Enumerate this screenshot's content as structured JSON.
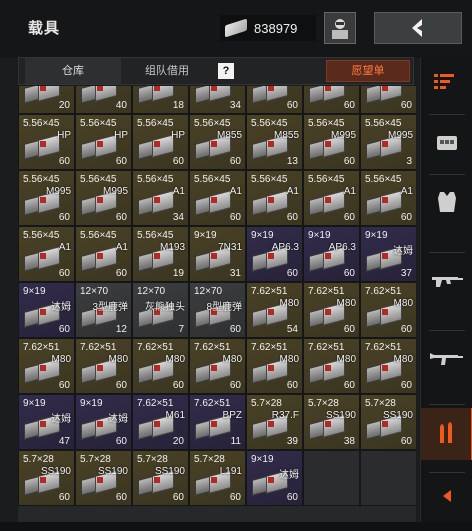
{
  "header": {
    "title": "载具",
    "money": "838979",
    "money_icon": "cash-icon",
    "avatar_icon": "character-icon",
    "back_icon": "back-arrow-icon"
  },
  "tabs": {
    "storage": "仓库",
    "team_borrow": "组队借用",
    "help": "?",
    "wishlist": "愿望单"
  },
  "colors": {
    "accent": "#f25a1c",
    "gold_slot": "#4a4226",
    "purple_slot": "#322c4c",
    "gray_slot": "#3c3d3f"
  },
  "rows": [
    [
      {
        "cal": "",
        "type": "",
        "qty": "20",
        "rarity": "gold"
      },
      {
        "cal": "",
        "type": "",
        "qty": "40",
        "rarity": "gold"
      },
      {
        "cal": "",
        "type": "",
        "qty": "18",
        "rarity": "gold"
      },
      {
        "cal": "",
        "type": "",
        "qty": "34",
        "rarity": "gold"
      },
      {
        "cal": "",
        "type": "",
        "qty": "60",
        "rarity": "gold"
      },
      {
        "cal": "",
        "type": "",
        "qty": "60",
        "rarity": "gold"
      },
      {
        "cal": "",
        "type": "",
        "qty": "60",
        "rarity": "gold"
      }
    ],
    [
      {
        "cal": "5.56×45",
        "type": "HP",
        "qty": "60",
        "rarity": "gold"
      },
      {
        "cal": "5.56×45",
        "type": "HP",
        "qty": "60",
        "rarity": "gold"
      },
      {
        "cal": "5.56×45",
        "type": "HP",
        "qty": "60",
        "rarity": "gold"
      },
      {
        "cal": "5.56×45",
        "type": "M855",
        "qty": "60",
        "rarity": "gold"
      },
      {
        "cal": "5.56×45",
        "type": "M855",
        "qty": "13",
        "rarity": "gold"
      },
      {
        "cal": "5.56×45",
        "type": "M995",
        "qty": "60",
        "rarity": "gold"
      },
      {
        "cal": "5.56×45",
        "type": "M995",
        "qty": "3",
        "rarity": "gold"
      }
    ],
    [
      {
        "cal": "5.56×45",
        "type": "M995",
        "qty": "60",
        "rarity": "gold"
      },
      {
        "cal": "5.56×45",
        "type": "M995",
        "qty": "60",
        "rarity": "gold"
      },
      {
        "cal": "5.56×45",
        "type": "A1",
        "qty": "34",
        "rarity": "gold"
      },
      {
        "cal": "5.56×45",
        "type": "A1",
        "qty": "60",
        "rarity": "gold"
      },
      {
        "cal": "5.56×45",
        "type": "A1",
        "qty": "60",
        "rarity": "gold"
      },
      {
        "cal": "5.56×45",
        "type": "A1",
        "qty": "60",
        "rarity": "gold"
      },
      {
        "cal": "5.56×45",
        "type": "A1",
        "qty": "60",
        "rarity": "gold"
      }
    ],
    [
      {
        "cal": "5.56×45",
        "type": "A1",
        "qty": "60",
        "rarity": "gold"
      },
      {
        "cal": "5.56×45",
        "type": "A1",
        "qty": "60",
        "rarity": "gold"
      },
      {
        "cal": "5.56×45",
        "type": "M193",
        "qty": "19",
        "rarity": "gold"
      },
      {
        "cal": "9×19",
        "type": "7N31",
        "qty": "31",
        "rarity": "gold"
      },
      {
        "cal": "9×19",
        "type": "AP6.3",
        "qty": "60",
        "rarity": "purple"
      },
      {
        "cal": "9×19",
        "type": "AP6.3",
        "qty": "60",
        "rarity": "purple"
      },
      {
        "cal": "9×19",
        "type": "达姆",
        "qty": "37",
        "rarity": "purple"
      }
    ],
    [
      {
        "cal": "9×19",
        "type": "达姆",
        "qty": "60",
        "rarity": "purple"
      },
      {
        "cal": "12×70",
        "type": "3型鹿弹",
        "qty": "12",
        "rarity": "gray"
      },
      {
        "cal": "12×70",
        "type": "灰熊独头",
        "qty": "7",
        "rarity": "gray"
      },
      {
        "cal": "12×70",
        "type": "8型鹿弹",
        "qty": "60",
        "rarity": "gray"
      },
      {
        "cal": "7.62×51",
        "type": "M80",
        "qty": "54",
        "rarity": "gold"
      },
      {
        "cal": "7.62×51",
        "type": "M80",
        "qty": "60",
        "rarity": "gold"
      },
      {
        "cal": "7.62×51",
        "type": "M80",
        "qty": "60",
        "rarity": "gold"
      }
    ],
    [
      {
        "cal": "7.62×51",
        "type": "M80",
        "qty": "60",
        "rarity": "gold"
      },
      {
        "cal": "7.62×51",
        "type": "M80",
        "qty": "60",
        "rarity": "gold"
      },
      {
        "cal": "7.62×51",
        "type": "M80",
        "qty": "60",
        "rarity": "gold"
      },
      {
        "cal": "7.62×51",
        "type": "M80",
        "qty": "60",
        "rarity": "gold"
      },
      {
        "cal": "7.62×51",
        "type": "M80",
        "qty": "60",
        "rarity": "gold"
      },
      {
        "cal": "7.62×51",
        "type": "M80",
        "qty": "60",
        "rarity": "gold"
      },
      {
        "cal": "7.62×51",
        "type": "M80",
        "qty": "60",
        "rarity": "gold"
      }
    ],
    [
      {
        "cal": "9×19",
        "type": "达姆",
        "qty": "47",
        "rarity": "purple"
      },
      {
        "cal": "9×19",
        "type": "达姆",
        "qty": "60",
        "rarity": "purple"
      },
      {
        "cal": "7.62×51",
        "type": "M61",
        "qty": "20",
        "rarity": "purple"
      },
      {
        "cal": "7.62×51",
        "type": "BPZ",
        "qty": "11",
        "rarity": "purple"
      },
      {
        "cal": "5.7×28",
        "type": "R37.F",
        "qty": "39",
        "rarity": "gold"
      },
      {
        "cal": "5.7×28",
        "type": "SS190",
        "qty": "38",
        "rarity": "gold"
      },
      {
        "cal": "5.7×28",
        "type": "SS190",
        "qty": "60",
        "rarity": "gold"
      }
    ],
    [
      {
        "cal": "5.7×28",
        "type": "SS190",
        "qty": "60",
        "rarity": "gold"
      },
      {
        "cal": "5.7×28",
        "type": "SS190",
        "qty": "60",
        "rarity": "gold"
      },
      {
        "cal": "5.7×28",
        "type": "SS190",
        "qty": "60",
        "rarity": "gold"
      },
      {
        "cal": "5.7×28",
        "type": "L191",
        "qty": "60",
        "rarity": "gold"
      },
      {
        "cal": "9×19",
        "type": "达姆",
        "qty": "60",
        "rarity": "purple"
      },
      {
        "cal": "",
        "type": "",
        "qty": "",
        "rarity": "empty"
      },
      {
        "cal": "",
        "type": "",
        "qty": "",
        "rarity": "empty"
      }
    ]
  ],
  "sidebar": [
    {
      "icon": "sort-icon"
    },
    {
      "icon": "armor-rig-icon"
    },
    {
      "icon": "vest-icon"
    },
    {
      "icon": "rifle-icon"
    },
    {
      "icon": "assault-rifle-icon"
    },
    {
      "icon": "ammo-icon",
      "active": true
    },
    {
      "icon": "arrow-left-icon"
    }
  ]
}
